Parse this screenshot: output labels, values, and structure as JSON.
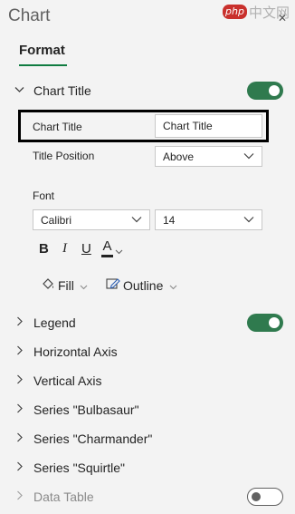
{
  "pane": {
    "title": "Chart"
  },
  "watermark": {
    "logo": "php",
    "text": "中文网"
  },
  "tabs": {
    "format": "Format"
  },
  "chart_title": {
    "section_label": "Chart Title",
    "toggle": "on",
    "title_label": "Chart Title",
    "title_value": "Chart Title",
    "position_label": "Title Position",
    "position_value": "Above"
  },
  "font": {
    "heading": "Font",
    "family": "Calibri",
    "size": "14",
    "bold": "B",
    "italic": "I",
    "underline": "U",
    "color": "A"
  },
  "fill": {
    "label": "Fill"
  },
  "outline": {
    "label": "Outline"
  },
  "sections": {
    "legend": "Legend",
    "legend_toggle": "on",
    "horizontal_axis": "Horizontal Axis",
    "vertical_axis": "Vertical Axis",
    "series1": "Series \"Bulbasaur\"",
    "series2": "Series \"Charmander\"",
    "series3": "Series \"Squirtle\"",
    "data_table": "Data Table",
    "data_table_toggle": "off"
  }
}
